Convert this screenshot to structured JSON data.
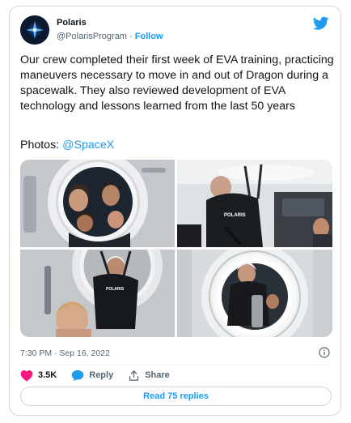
{
  "author": {
    "name": "Polaris",
    "handle": "@PolarisProgram",
    "separator": "·",
    "follow_label": "Follow"
  },
  "tweet": {
    "text": "Our crew completed their first week of EVA training, practicing maneuvers necessary to move in and out of Dragon during a spacewalk. They also reviewed development of EVA technology and lessons learned from the last 50 years",
    "photos_label": "Photos:",
    "photos_mention": "@SpaceX",
    "timestamp": "7:30 PM · Sep 16, 2022"
  },
  "photos": [
    {
      "icon": "crew-in-hatch-photo",
      "suit_label": ""
    },
    {
      "icon": "crew-hanging-harness-photo",
      "suit_label": "POLARIS"
    },
    {
      "icon": "crew-hatch-training-photo",
      "suit_label": "POLARIS"
    },
    {
      "icon": "crew-through-hatch-photo",
      "suit_label": ""
    }
  ],
  "actions": {
    "like_count": "3.5K",
    "reply_label": "Reply",
    "share_label": "Share"
  },
  "replies_button": "Read 75 replies",
  "colors": {
    "accent": "#1d9bf0",
    "like": "#f91880",
    "text": "#0f1419",
    "muted": "#536471"
  }
}
